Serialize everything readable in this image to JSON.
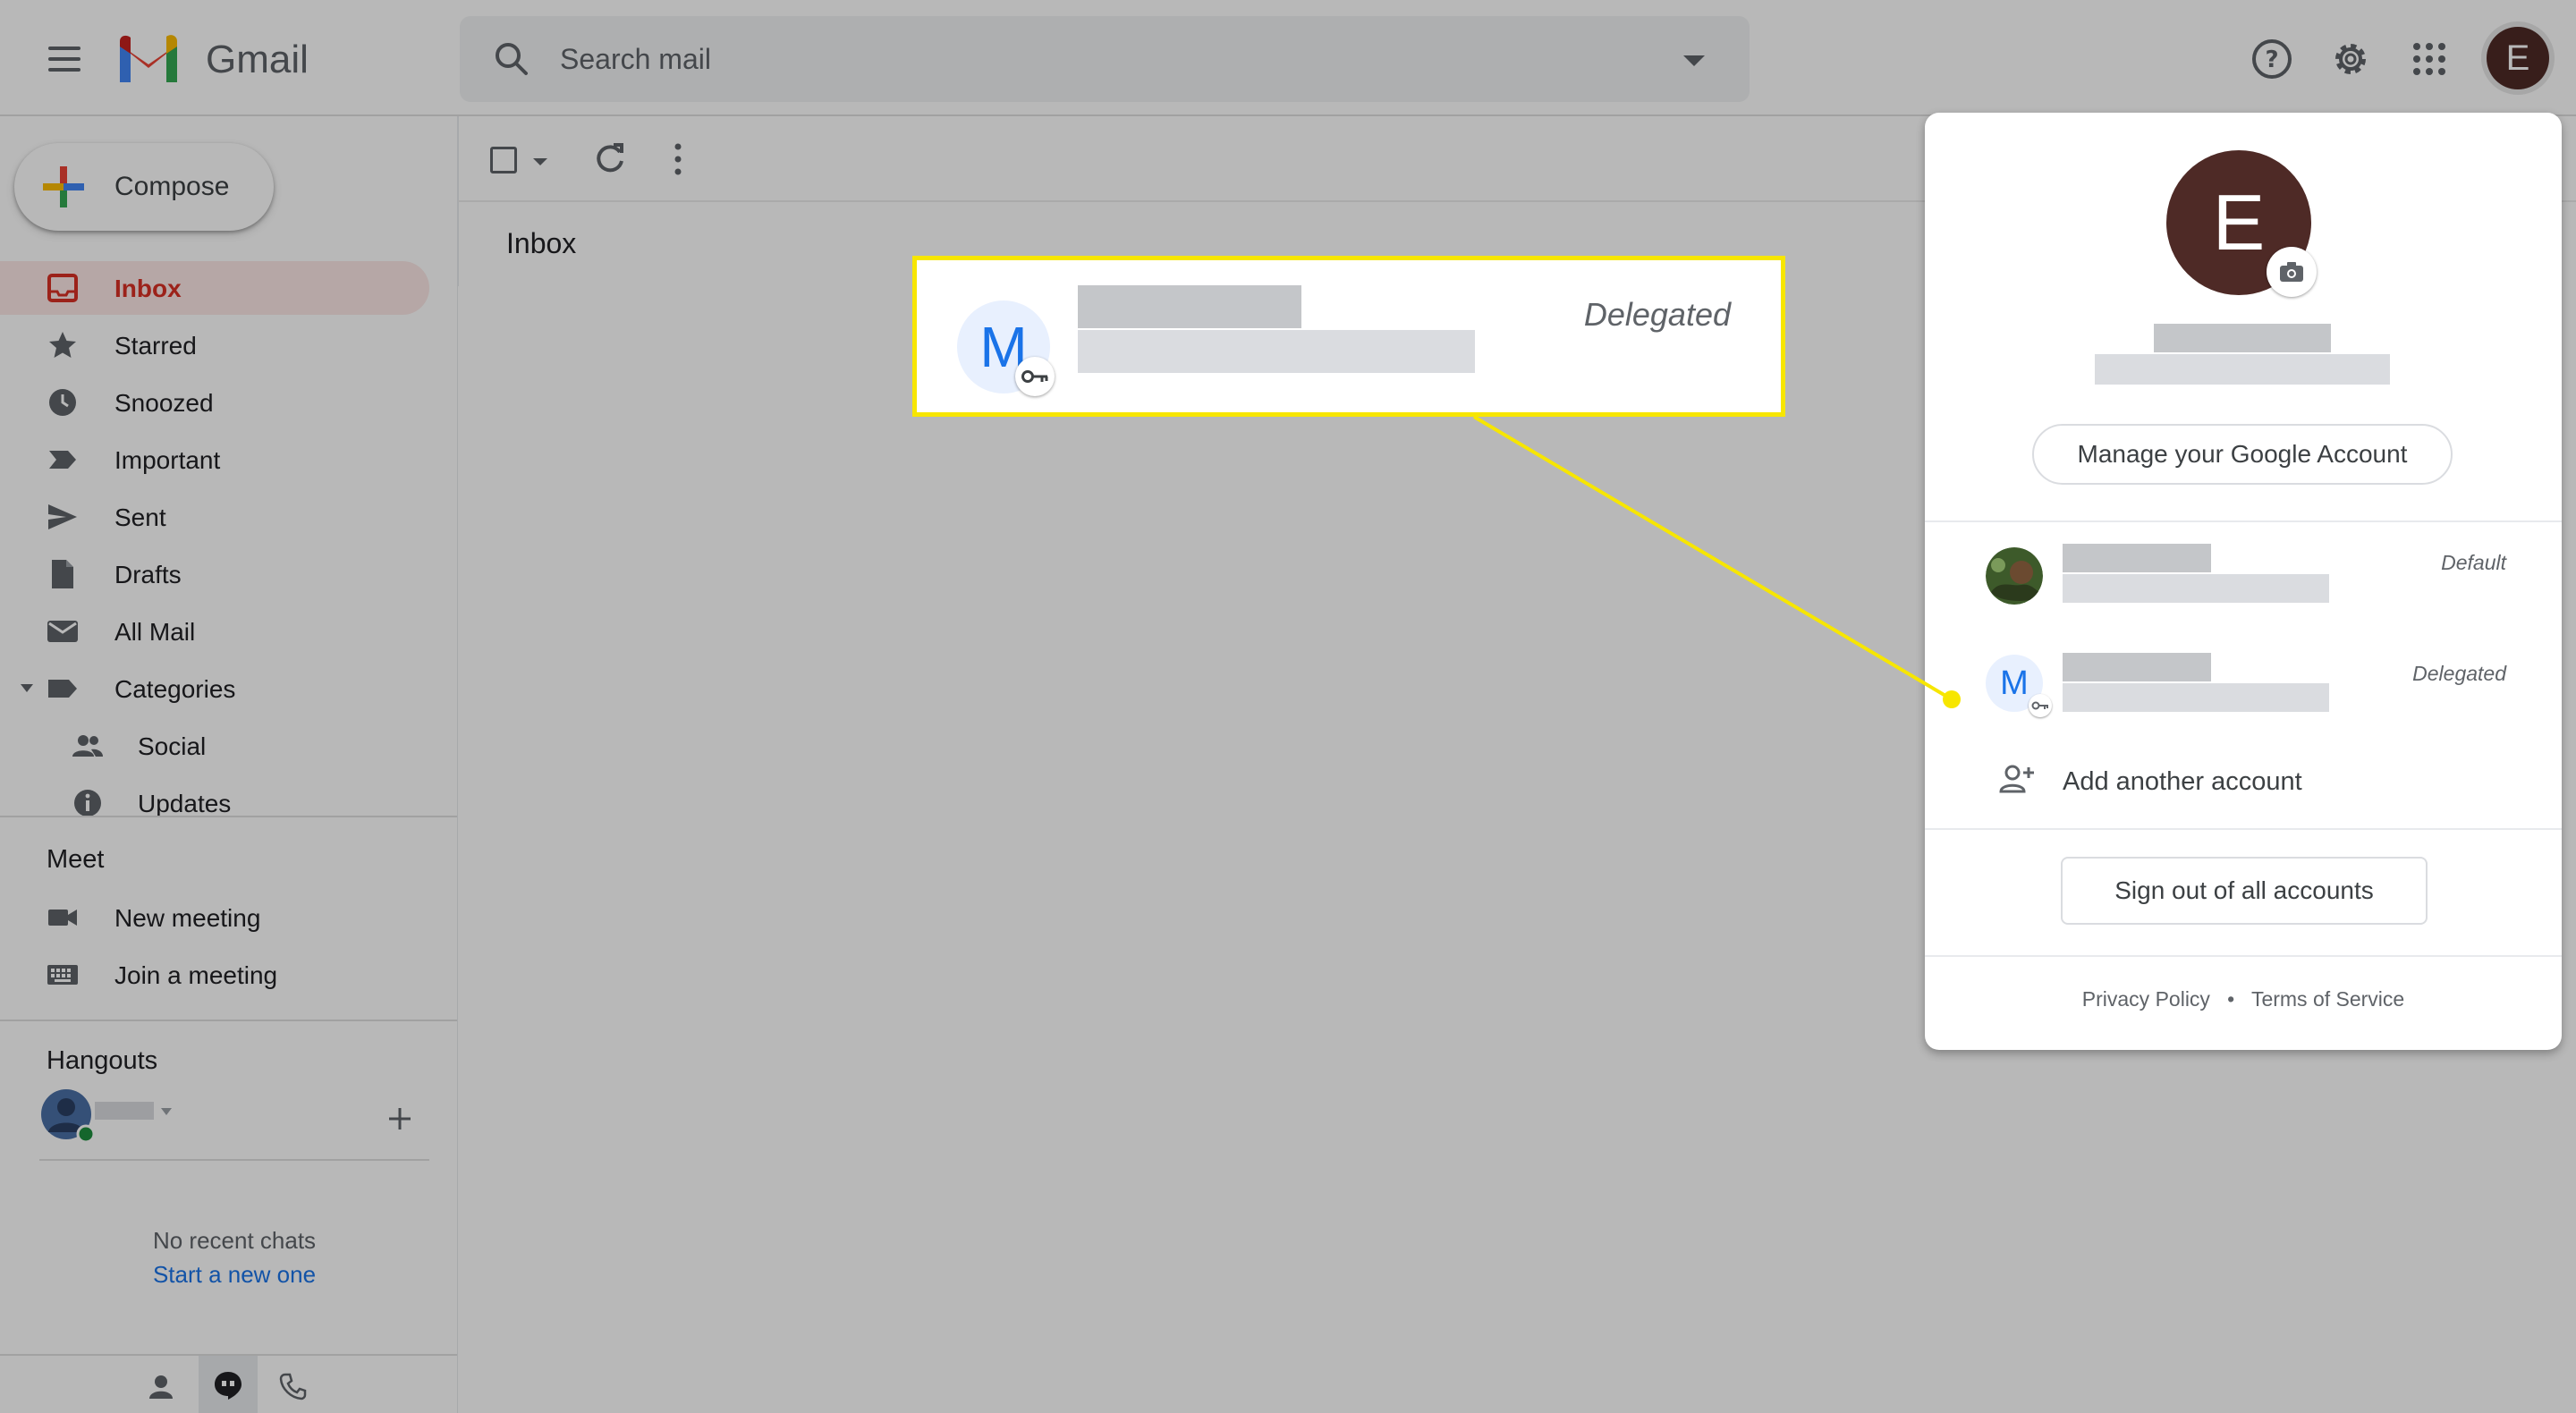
{
  "app": {
    "name": "Gmail"
  },
  "search": {
    "placeholder": "Search mail"
  },
  "user": {
    "initial": "E"
  },
  "compose": {
    "label": "Compose"
  },
  "sidebar": {
    "items": [
      {
        "label": "Inbox",
        "icon": "inbox-icon"
      },
      {
        "label": "Starred",
        "icon": "star-icon"
      },
      {
        "label": "Snoozed",
        "icon": "clock-icon"
      },
      {
        "label": "Important",
        "icon": "important-icon"
      },
      {
        "label": "Sent",
        "icon": "send-icon"
      },
      {
        "label": "Drafts",
        "icon": "draft-icon"
      },
      {
        "label": "All Mail",
        "icon": "mail-icon"
      },
      {
        "label": "Categories",
        "icon": "label-icon"
      },
      {
        "label": "Social",
        "icon": "people-icon"
      },
      {
        "label": "Updates",
        "icon": "info-icon"
      }
    ]
  },
  "meet": {
    "title": "Meet",
    "items": [
      {
        "label": "New meeting",
        "icon": "video-icon"
      },
      {
        "label": "Join a meeting",
        "icon": "keyboard-icon"
      }
    ]
  },
  "hangouts": {
    "title": "Hangouts",
    "no_chats": "No recent chats",
    "start_new": "Start a new one"
  },
  "main": {
    "tab": "Inbox"
  },
  "callout": {
    "initial": "M",
    "tag": "Delegated"
  },
  "account_menu": {
    "initial": "E",
    "manage_label": "Manage your Google Account",
    "accounts": [
      {
        "tag": "Default"
      },
      {
        "initial": "M",
        "tag": "Delegated"
      }
    ],
    "add_account": "Add another account",
    "sign_out": "Sign out of all accounts",
    "privacy": "Privacy Policy",
    "separator": "•",
    "terms": "Terms of Service"
  },
  "colors": {
    "gmail_red": "#d93025",
    "highlight_yellow": "#f7e600",
    "avatar_brown": "#4e2a26",
    "link_blue": "#1a73e8"
  }
}
